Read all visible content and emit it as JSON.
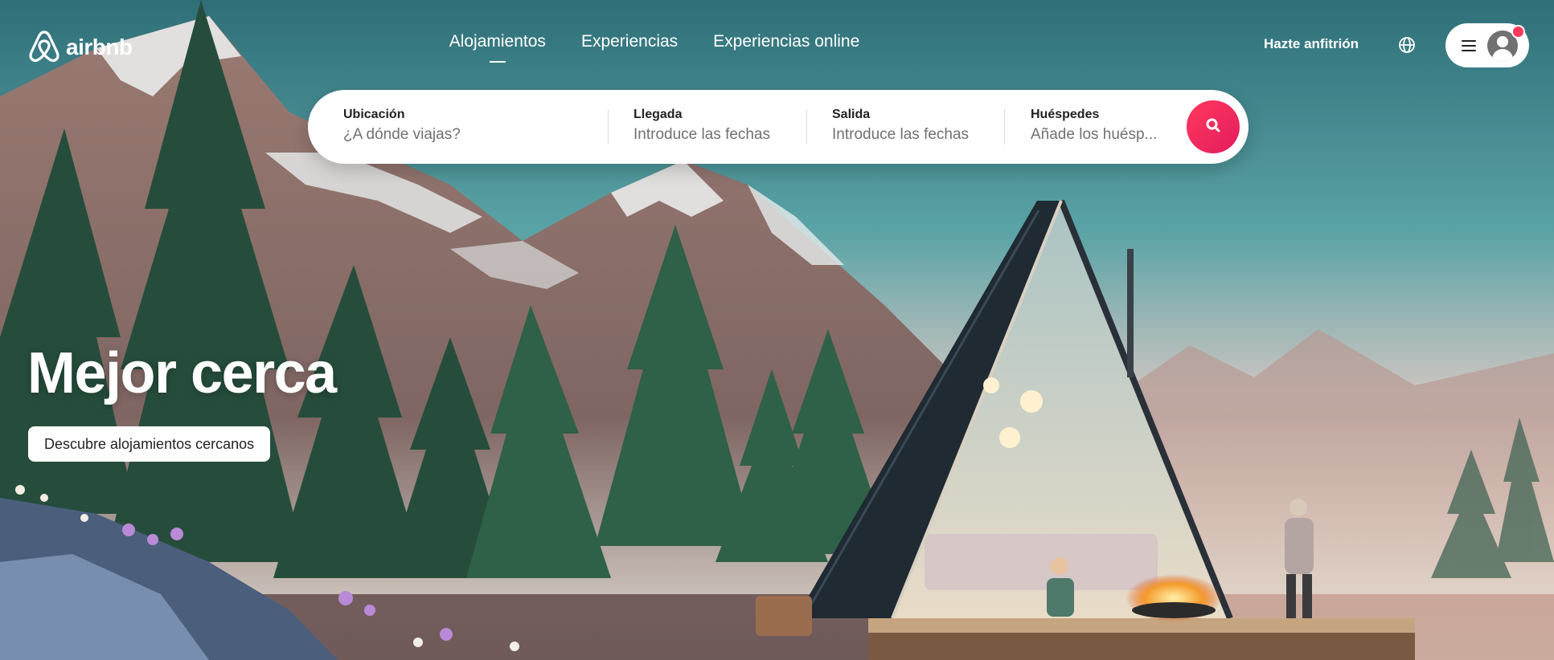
{
  "brand": {
    "name": "airbnb",
    "logo_icon": "airbnb-belo-icon",
    "accent": "#ff385c"
  },
  "nav": {
    "tabs": [
      {
        "label": "Alojamientos",
        "active": true
      },
      {
        "label": "Experiencias",
        "active": false
      },
      {
        "label": "Experiencias online",
        "active": false
      }
    ]
  },
  "header_right": {
    "host_label": "Hazte anfitrión",
    "globe_icon": "globe-icon",
    "menu_icon": "hamburger-menu-icon",
    "avatar_icon": "user-avatar-icon",
    "has_notification": true
  },
  "search": {
    "fields": [
      {
        "label": "Ubicación",
        "placeholder": "¿A dónde viajas?"
      },
      {
        "label": "Llegada",
        "placeholder": "Introduce las fechas"
      },
      {
        "label": "Salida",
        "placeholder": "Introduce las fechas"
      },
      {
        "label": "Huéspedes",
        "placeholder": "Añade los huésp..."
      }
    ],
    "button_icon": "search-icon"
  },
  "hero": {
    "title": "Mejor cerca",
    "cta_label": "Descubre alojamientos cercanos"
  }
}
